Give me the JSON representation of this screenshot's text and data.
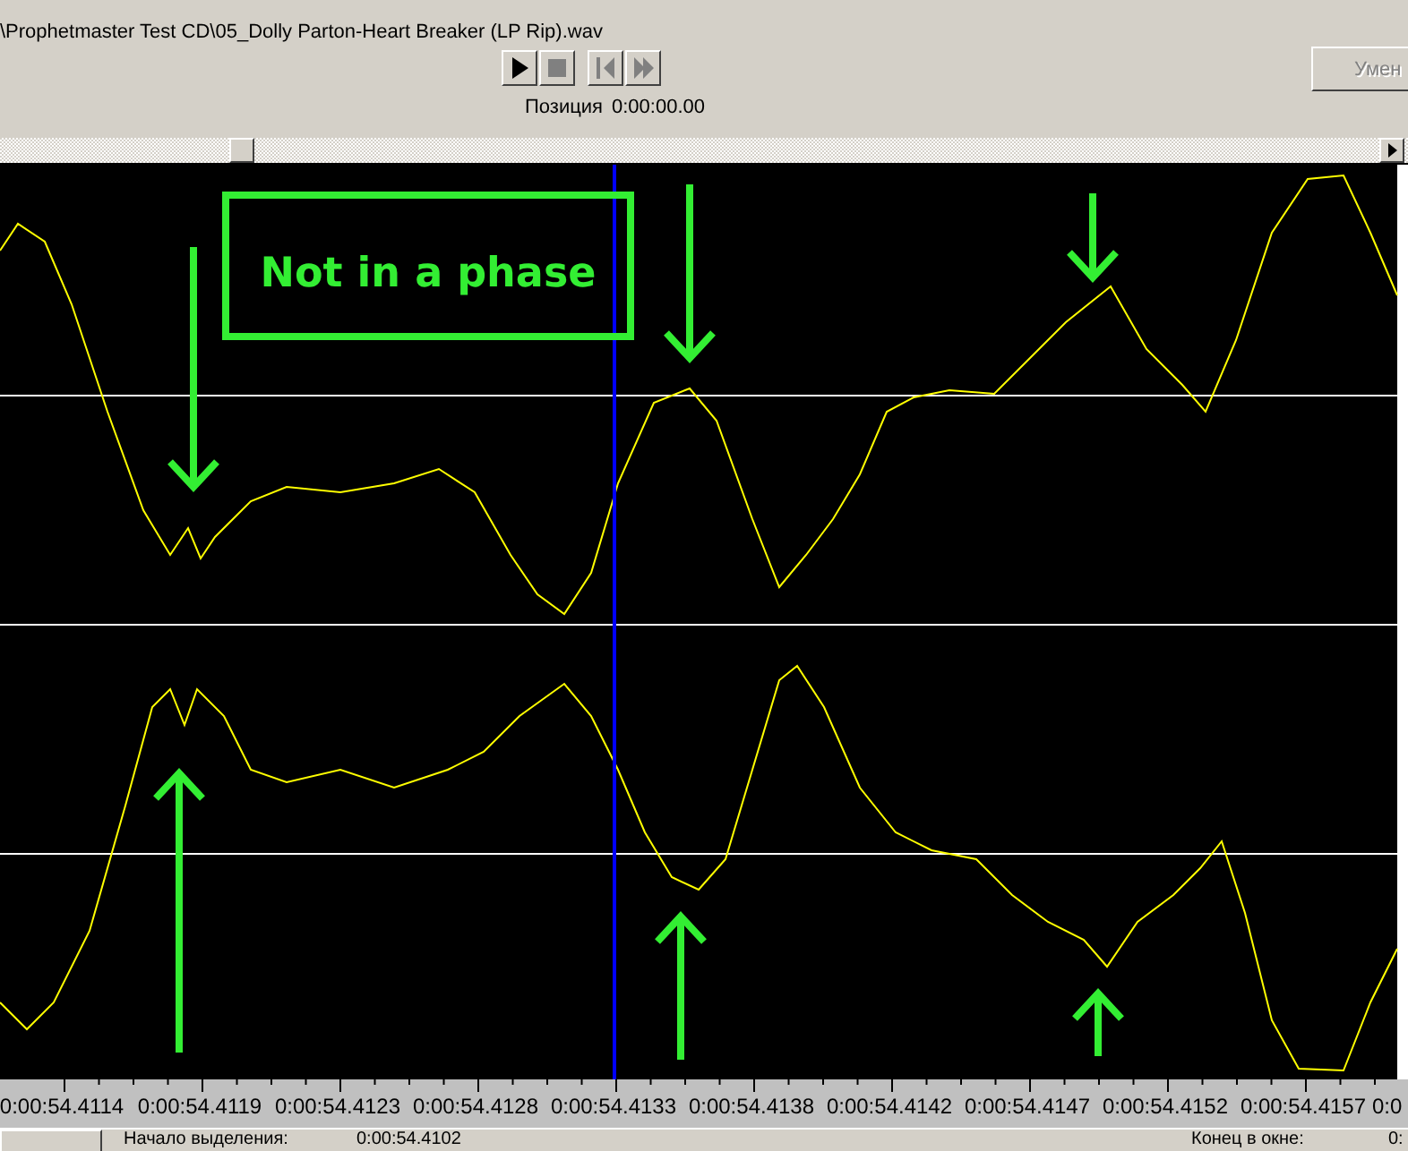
{
  "file_path": "\\Prophetmaster Test CD\\05_Dolly Parton-Heart Breaker (LP Rip).wav",
  "transport": [
    {
      "kind": "play",
      "disabled": false
    },
    {
      "kind": "stop",
      "disabled": true
    },
    {
      "kind": "rewind",
      "disabled": true
    },
    {
      "kind": "forward",
      "disabled": true
    }
  ],
  "position": {
    "label": "Позиция",
    "value": "0:00:00.00"
  },
  "zoom_button": {
    "label": "Умен",
    "disabled": true
  },
  "annotation": {
    "text": "Not in a phase"
  },
  "time_axis": {
    "labels": [
      "0:00:54.4114",
      "0:00:54.4119",
      "0:00:54.4123",
      "0:00:54.4128",
      "0:00:54.4133",
      "0:00:54.4138",
      "0:00:54.4142",
      "0:00:54.4147",
      "0:00:54.4152",
      "0:00:54.4157",
      "0:0"
    ]
  },
  "status_bar": {
    "selection_start_label": "Начало выделения:",
    "selection_start_value": "0:00:54.4102",
    "window_end_label": "Конец в окне:",
    "window_end_value": "0:"
  }
}
